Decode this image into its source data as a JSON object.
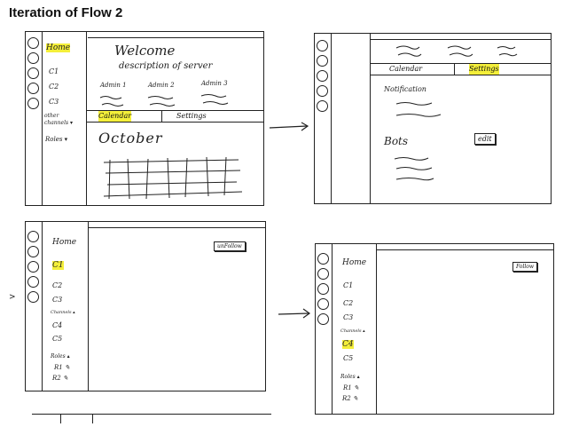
{
  "title": "Iteration of Flow 2",
  "frame1": {
    "sidebar": [
      "Home",
      "C1",
      "C2",
      "C3",
      "other channels ▾",
      "Roles ▾"
    ],
    "welcome": "Welcome",
    "description": "description of server",
    "admins": [
      "Admin 1",
      "Admin 2",
      "Admin 3"
    ],
    "tabs": [
      "Calendar",
      "Settings"
    ],
    "month": "October"
  },
  "frame2": {
    "tabs": [
      "Calendar",
      "Settings"
    ],
    "notification": "Notification",
    "bots": "Bots",
    "edit": "edit"
  },
  "frame3": {
    "sidebar": [
      "Home",
      "C1",
      "C2",
      "C3",
      "Channels ▴",
      "C4",
      "C5",
      "Roles ▴",
      "R1 ✎",
      "R2 ✎"
    ],
    "button": "unFollow"
  },
  "frame4": {
    "sidebar": [
      "Home",
      "C1",
      "C2",
      "C3",
      "Channels ▴",
      "C4",
      "C5",
      "Roles ▴",
      "R1 ✎",
      "R2 ✎"
    ],
    "button": "Follow"
  },
  "left_mark": ">",
  "highlight_color": "#f4ef3a"
}
